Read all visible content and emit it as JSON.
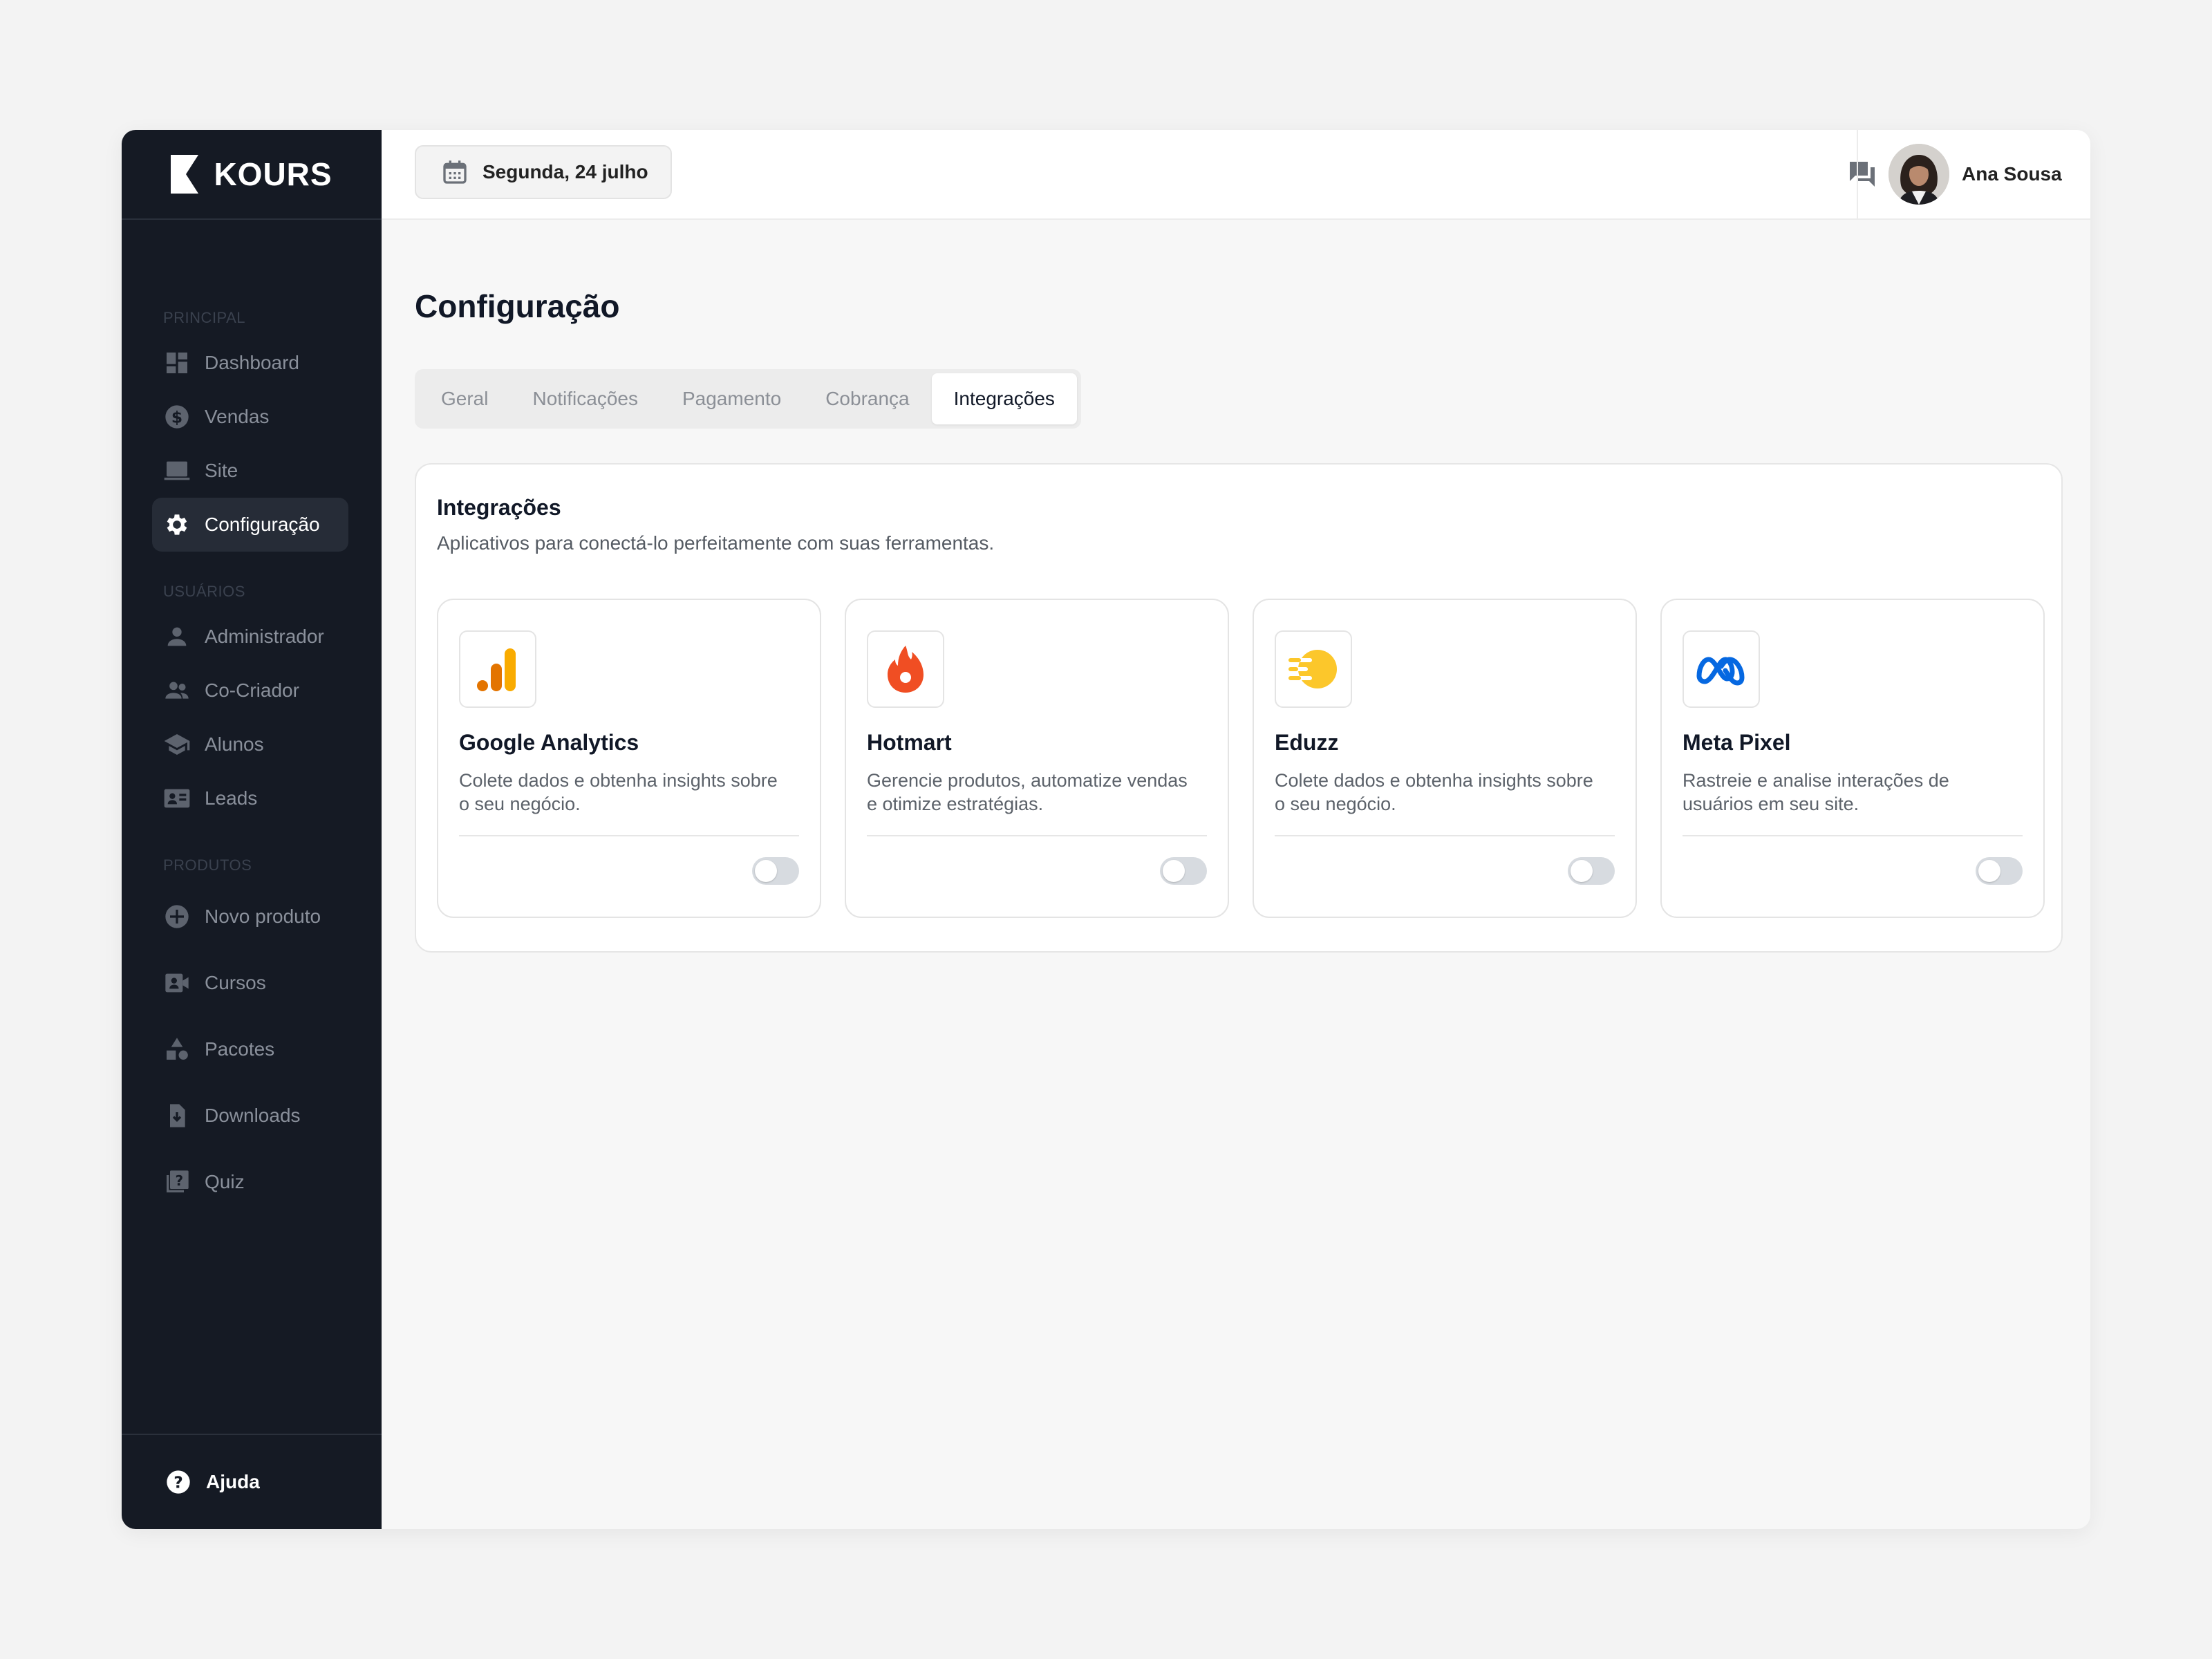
{
  "brand": {
    "name": "KOURS"
  },
  "sidebar": {
    "sections": [
      {
        "title": "PRINCIPAL",
        "items": [
          {
            "label": "Dashboard",
            "icon": "dashboard-icon"
          },
          {
            "label": "Vendas",
            "icon": "dollar-icon"
          },
          {
            "label": "Site",
            "icon": "laptop-icon"
          },
          {
            "label": "Configuração",
            "icon": "gear-icon",
            "active": true
          }
        ]
      },
      {
        "title": "USUÁRIOS",
        "items": [
          {
            "label": "Administrador",
            "icon": "user-icon"
          },
          {
            "label": "Co-Criador",
            "icon": "users-icon"
          },
          {
            "label": "Alunos",
            "icon": "graduation-cap-icon"
          },
          {
            "label": "Leads",
            "icon": "contact-card-icon"
          }
        ]
      },
      {
        "title": "PRODUTOS",
        "items": [
          {
            "label": "Novo produto",
            "icon": "plus-circle-icon"
          },
          {
            "label": "Cursos",
            "icon": "video-icon"
          },
          {
            "label": "Pacotes",
            "icon": "shapes-icon"
          },
          {
            "label": "Downloads",
            "icon": "download-file-icon"
          },
          {
            "label": "Quiz",
            "icon": "quiz-icon"
          }
        ]
      }
    ],
    "help_label": "Ajuda"
  },
  "topbar": {
    "date": "Segunda, 24 julho",
    "user_name": "Ana Sousa"
  },
  "page": {
    "title": "Configuração",
    "tabs": [
      {
        "label": "Geral"
      },
      {
        "label": "Notificações"
      },
      {
        "label": "Pagamento"
      },
      {
        "label": "Cobrança"
      },
      {
        "label": "Integrações",
        "active": true
      }
    ]
  },
  "integrations": {
    "title": "Integrações",
    "subtitle": "Aplicativos para conectá-lo perfeitamente com suas ferramentas.",
    "cards": [
      {
        "name": "Google Analytics",
        "description": "Colete dados e obtenha insights sobre o seu negócio.",
        "icon": "google-analytics-icon",
        "enabled": false
      },
      {
        "name": "Hotmart",
        "description": "Gerencie produtos, automatize vendas e otimize estratégias.",
        "icon": "hotmart-icon",
        "enabled": false
      },
      {
        "name": "Eduzz",
        "description": "Colete dados e obtenha insights sobre o seu negócio.",
        "icon": "eduzz-icon",
        "enabled": false
      },
      {
        "name": "Meta Pixel",
        "description": "Rastreie e analise interações de usuários em seu site.",
        "icon": "meta-icon",
        "enabled": false
      }
    ]
  },
  "colors": {
    "sidebar_bg": "#151a24",
    "ga_orange": "#f9ab00",
    "ga_dark_orange": "#e37400",
    "hotmart_orange": "#f04e23",
    "eduzz_yellow": "#fcc72b",
    "meta_blue": "#0668e1"
  }
}
